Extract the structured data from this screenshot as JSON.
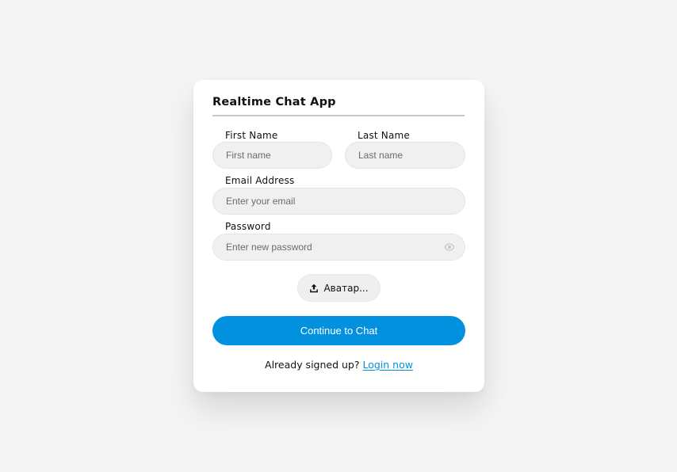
{
  "app": {
    "title": "Realtime Chat App"
  },
  "form": {
    "first_name": {
      "label": "First Name",
      "placeholder": "First name",
      "value": ""
    },
    "last_name": {
      "label": "Last Name",
      "placeholder": "Last name",
      "value": ""
    },
    "email": {
      "label": "Email Address",
      "placeholder": "Enter your email",
      "value": ""
    },
    "password": {
      "label": "Password",
      "placeholder": "Enter new password",
      "value": "",
      "toggle_icon": "eye-icon"
    },
    "avatar_button": {
      "label": "Аватар...",
      "icon": "upload-icon"
    },
    "submit_label": "Continue to Chat"
  },
  "footer": {
    "prompt": "Already signed up?",
    "link_label": "Login now"
  },
  "colors": {
    "accent": "#0291df",
    "background": "#f5f5f5",
    "card": "#ffffff",
    "field": "#f0f0f0"
  }
}
